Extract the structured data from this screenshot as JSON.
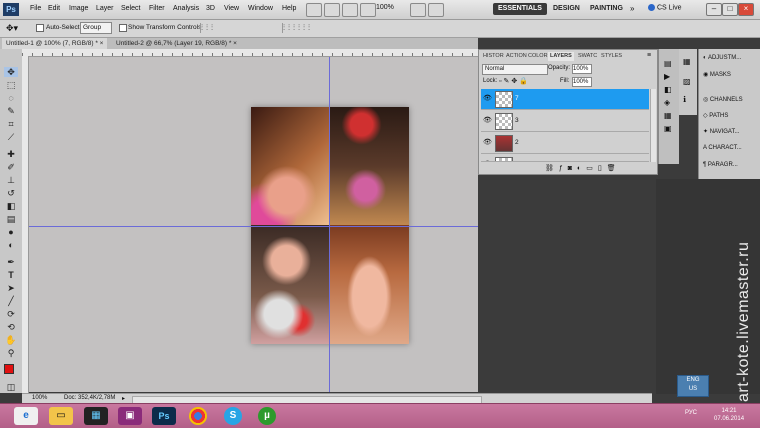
{
  "menubar": {
    "logo": "Ps",
    "items": [
      "File",
      "Edit",
      "Image",
      "Layer",
      "Select",
      "Filter",
      "Analysis",
      "3D",
      "View",
      "Window",
      "Help"
    ],
    "zoom": "100%",
    "workspaces": [
      "ESSENTIALS",
      "DESIGN",
      "PAINTING"
    ],
    "more": "»",
    "cslive": "CS Live",
    "window_buttons": [
      "–",
      "□",
      "×"
    ]
  },
  "options": {
    "auto_select_label": "Auto-Select:",
    "auto_select_value": "Group",
    "show_transform_label": "Show Transform Controls"
  },
  "tabs": [
    {
      "label": "Untitled-1 @ 100% (7, RGB/8) *  ×"
    },
    {
      "label": "Untitled-2 @ 66,7% (Layer 19, RGB/8) *  ×"
    }
  ],
  "status": {
    "zoom": "100%",
    "doc": "Doc: 352,4K/2,78M"
  },
  "layers_panel": {
    "tabs": [
      "HISTOR",
      "ACTION",
      "COLOR",
      "LAYERS",
      "SWATC",
      "STYLES"
    ],
    "blend_mode": "Normal",
    "opacity_label": "Opacity:",
    "opacity_value": "100%",
    "lock_label": "Lock:",
    "fill_label": "Fill:",
    "fill_value": "100%",
    "layers": [
      {
        "name": "7",
        "selected": true
      },
      {
        "name": "3",
        "selected": false
      },
      {
        "name": "2",
        "selected": false
      },
      {
        "name": "",
        "selected": false
      }
    ]
  },
  "dock_panel": {
    "items": [
      "ADJUSTM...",
      "MASKS",
      "CHANNELS",
      "PATHS",
      "NAVIGAT...",
      "CHARACT...",
      "PARAGR..."
    ]
  },
  "language_popup": {
    "line1": "ENG",
    "line2": "US"
  },
  "taskbar": {
    "tray_lang": "РУС",
    "time": "14:21",
    "date": "07.06.2014"
  },
  "watermark": "art-kote.livemaster.ru",
  "colors": {
    "selected_layer": "#1e9bf0",
    "guide": "#6b6bd8",
    "foreground_swatch": "#e01010",
    "taskbar": "#c26a94"
  }
}
